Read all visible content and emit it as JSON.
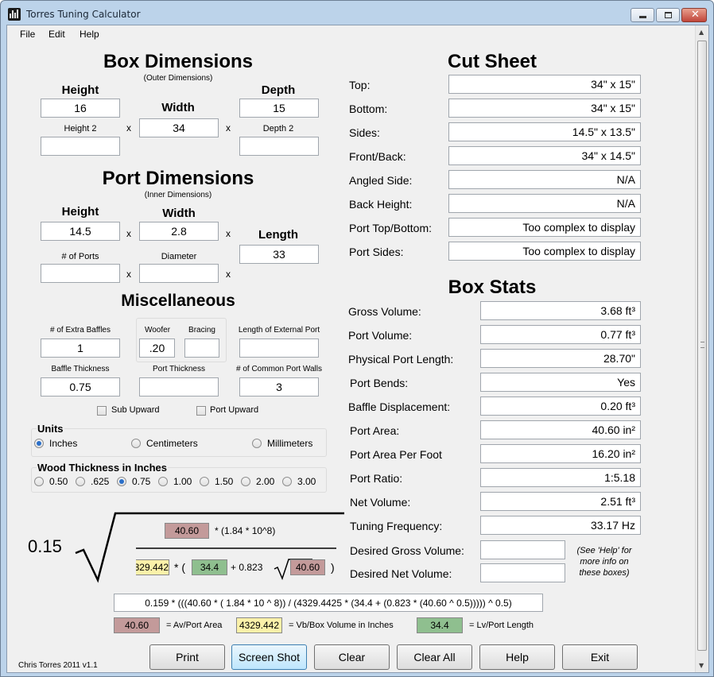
{
  "window": {
    "title": "Torres Tuning Calculator"
  },
  "menu": [
    "File",
    "Edit",
    "Help"
  ],
  "box_dimensions": {
    "title": "Box Dimensions",
    "subtitle": "(Outer Dimensions)",
    "height_label": "Height",
    "height": "16",
    "width_label": "Width",
    "width": "34",
    "depth_label": "Depth",
    "depth": "15",
    "height2_label": "Height 2",
    "height2": "",
    "depth2_label": "Depth 2",
    "depth2": "",
    "x": "x"
  },
  "port_dimensions": {
    "title": "Port Dimensions",
    "subtitle": "(Inner Dimensions)",
    "height_label": "Height",
    "height": "14.5",
    "width_label": "Width",
    "width": "2.8",
    "length_label": "Length",
    "length": "33",
    "ports_label": "# of Ports",
    "ports": "",
    "diameter_label": "Diameter",
    "diameter": ""
  },
  "misc": {
    "title": "Miscellaneous",
    "extra_baffles_label": "# of Extra Baffles",
    "extra_baffles": "1",
    "woofer_label": "Woofer",
    "woofer": ".20",
    "bracing_label": "Bracing",
    "bracing": "",
    "ext_port_label": "Length of External Port",
    "ext_port": "",
    "baffle_thickness_label": "Baffle Thickness",
    "baffle_thickness": "0.75",
    "port_thickness_label": "Port Thickness",
    "port_thickness": "",
    "common_walls_label": "# of Common Port Walls",
    "common_walls": "3",
    "sub_upward": "Sub Upward",
    "port_upward": "Port Upward"
  },
  "units": {
    "title": "Units",
    "options": [
      "Inches",
      "Centimeters",
      "Millimeters"
    ],
    "selected": "Inches"
  },
  "wood": {
    "title": "Wood Thickness in Inches",
    "options": [
      "0.50",
      ".625",
      "0.75",
      "1.00",
      "1.50",
      "2.00",
      "3.00"
    ],
    "selected": "0.75"
  },
  "cut_sheet": {
    "title": "Cut Sheet",
    "rows": [
      {
        "label": "Top:",
        "value": "34\" x 15\""
      },
      {
        "label": "Bottom:",
        "value": "34\" x 15\""
      },
      {
        "label": "Sides:",
        "value": "14.5\" x 13.5\""
      },
      {
        "label": "Front/Back:",
        "value": "34\" x 14.5\""
      },
      {
        "label": "Angled Side:",
        "value": "N/A"
      },
      {
        "label": "Back Height:",
        "value": "N/A"
      },
      {
        "label": "Port Top/Bottom:",
        "value": "Too complex to display"
      },
      {
        "label": "Port Sides:",
        "value": "Too complex to display"
      }
    ]
  },
  "box_stats": {
    "title": "Box Stats",
    "rows": [
      {
        "label": "Gross Volume:",
        "value": "3.68 ft³"
      },
      {
        "label": "Port Volume:",
        "value": "0.77 ft³"
      },
      {
        "label": "Physical Port Length:",
        "value": "28.70\""
      },
      {
        "label": "Port Bends:",
        "value": "Yes"
      },
      {
        "label": "Baffle Displacement:",
        "value": "0.20 ft³"
      },
      {
        "label": "Port Area:",
        "value": "40.60 in²"
      },
      {
        "label": "Port Area Per Foot",
        "value": "16.20 in²"
      },
      {
        "label": "Port Ratio:",
        "value": "1:5.18"
      },
      {
        "label": "Net Volume:",
        "value": "2.51 ft³"
      },
      {
        "label": "Tuning Frequency:",
        "value": "33.17 Hz"
      }
    ],
    "desired_gross_label": "Desired Gross Volume:",
    "desired_gross": "",
    "desired_net_label": "Desired Net Volume:",
    "desired_net": "",
    "note": "(See 'Help' for more info on these boxes)"
  },
  "formula": {
    "coef": "0.15",
    "num_value": "40.60",
    "num_text": "* (1.84 * 10^8)",
    "den_value": "329.442",
    "den_open": "* (",
    "den_lv": "34.4",
    "den_mid": "+ 0.823",
    "den_av": "40.60",
    "den_close": ")",
    "expression": "0.159 * (((40.60 * ( 1.84 * 10 ^ 8)) / (4329.4425 * (34.4 + (0.823 * (40.60 ^ 0.5))))) ^ 0.5)"
  },
  "legend": [
    {
      "value": "40.60",
      "label": "= Av/Port Area",
      "color": "#c39a9a"
    },
    {
      "value": "4329.442",
      "label": "= Vb/Box Volume in Inches",
      "color": "#fbf1a9"
    },
    {
      "value": "34.4",
      "label": "= Lv/Port Length",
      "color": "#8fbf8f"
    }
  ],
  "footer": {
    "credit": "Chris Torres 2011 v1.1"
  },
  "buttons": [
    "Print",
    "Screen Shot",
    "Clear",
    "Clear All",
    "Help",
    "Exit"
  ]
}
